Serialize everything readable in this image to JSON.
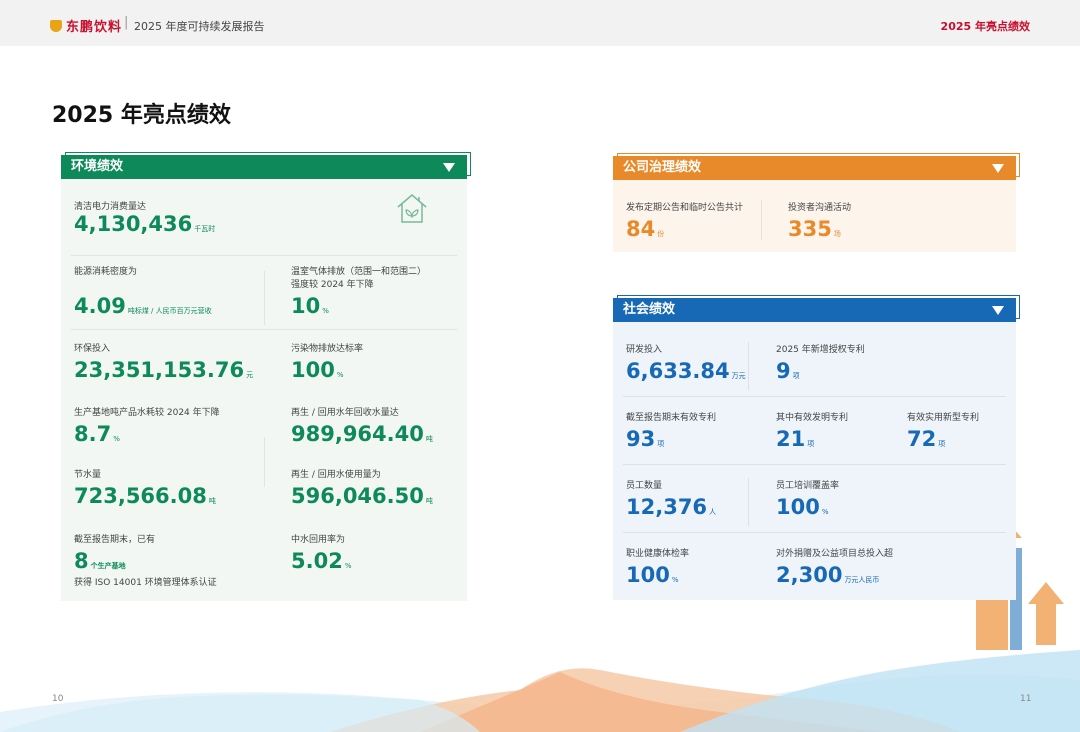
{
  "header": {
    "brand": "东鹏饮料",
    "report_title": "2025 年度可持续发展报告",
    "section": "2025 年亮点绩效"
  },
  "page_title": "2025 年亮点绩效",
  "env": {
    "title": "环境绩效",
    "metrics": [
      {
        "label": "清洁电力消费量达",
        "value": "4,130,436",
        "unit": "千瓦时"
      },
      {
        "label": "能源消耗密度为",
        "value": "4.09",
        "unit": "吨标煤 / 人民币百万元营收"
      },
      {
        "label": "温室气体排放（范围一和范围二）",
        "label2": "强度较 2024 年下降",
        "value": "10",
        "unit": "%"
      },
      {
        "label": "环保投入",
        "value": "23,351,153.76",
        "unit": "元"
      },
      {
        "label": "污染物排放达标率",
        "value": "100",
        "unit": "%"
      },
      {
        "label": "生产基地吨产品水耗较 2024 年下降",
        "value": "8.7",
        "unit": "%"
      },
      {
        "label": "再生 / 回用水年回收水量达",
        "value": "989,964.40",
        "unit": "吨"
      },
      {
        "label": "节水量",
        "value": "723,566.08",
        "unit": "吨"
      },
      {
        "label": "再生 / 回用水使用量为",
        "value": "596,046.50",
        "unit": "吨"
      },
      {
        "label": "截至报告期末，已有",
        "value": "8",
        "unit": "个生产基地",
        "extra": "获得 ISO 14001 环境管理体系认证"
      },
      {
        "label": "中水回用率为",
        "value": "5.02",
        "unit": "%"
      }
    ]
  },
  "gov": {
    "title": "公司治理绩效",
    "metrics": [
      {
        "label": "发布定期公告和临时公告共计",
        "value": "84",
        "unit": "份"
      },
      {
        "label": "投资者沟通活动",
        "value": "335",
        "unit": "场"
      }
    ]
  },
  "soc": {
    "title": "社会绩效",
    "metrics": [
      {
        "label": "研发投入",
        "value": "6,633.84",
        "unit": "万元"
      },
      {
        "label": "2025 年新增授权专利",
        "value": "9",
        "unit": "项"
      },
      {
        "label": "截至报告期末有效专利",
        "value": "93",
        "unit": "项"
      },
      {
        "label": "其中有效发明专利",
        "value": "21",
        "unit": "项"
      },
      {
        "label": "有效实用新型专利",
        "value": "72",
        "unit": "项"
      },
      {
        "label": "员工数量",
        "value": "12,376",
        "unit": "人"
      },
      {
        "label": "员工培训覆盖率",
        "value": "100",
        "unit": "%"
      },
      {
        "label": "职业健康体检率",
        "value": "100",
        "unit": "%"
      },
      {
        "label": "对外捐赠及公益项目总投入超",
        "value": "2,300",
        "unit": "万元人民币"
      }
    ]
  },
  "page_numbers": {
    "left": "10",
    "right": "11"
  },
  "colors": {
    "env": "#0e8a5a",
    "gov": "#e98a2a",
    "soc": "#1769b5",
    "accent": "#c8102e"
  }
}
